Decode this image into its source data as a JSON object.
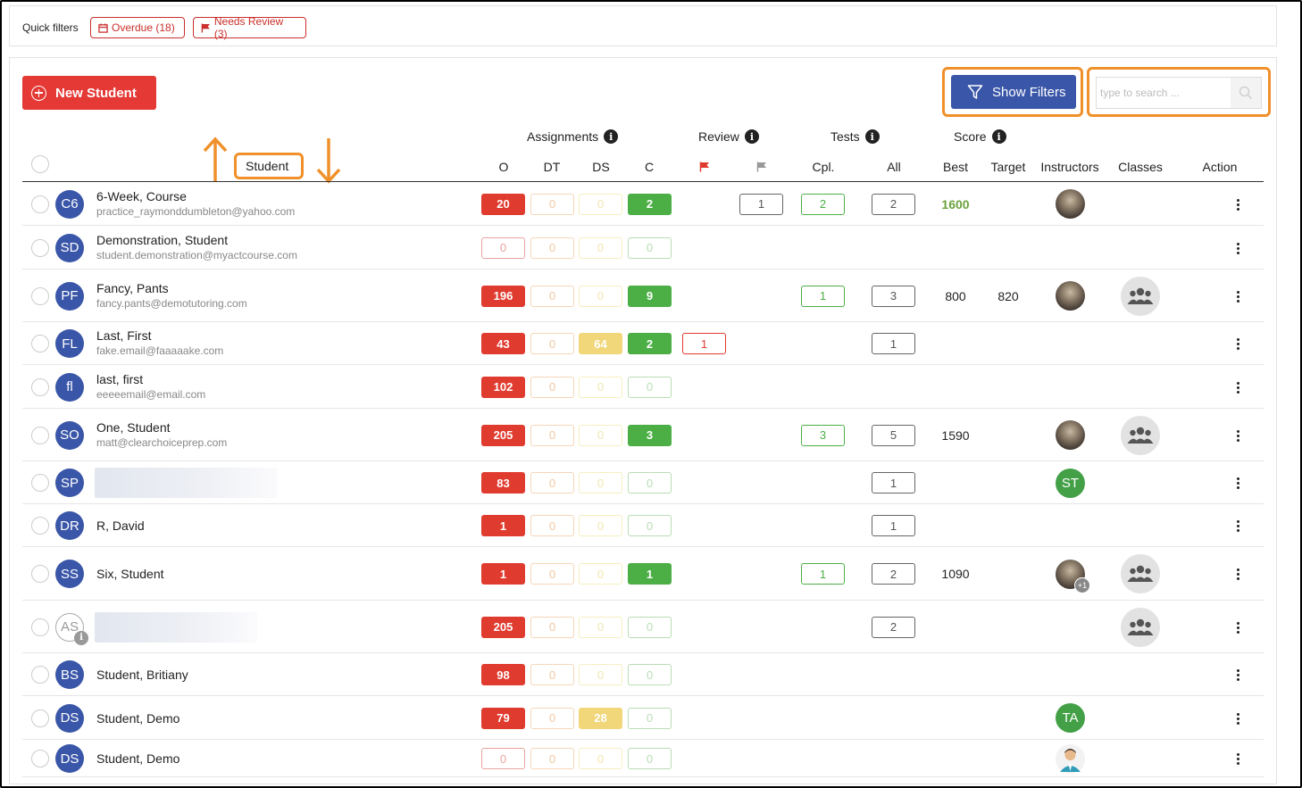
{
  "quick_filters": {
    "label": "Quick filters",
    "overdue": "Overdue (18)",
    "needs_review": "Needs Review (3)"
  },
  "toolbar": {
    "new_student": "New Student",
    "show_filters": "Show Filters",
    "search_placeholder": "type to search ..."
  },
  "groups": {
    "assignments": "Assignments",
    "review": "Review",
    "tests": "Tests",
    "score": "Score"
  },
  "columns": {
    "student": "Student",
    "o": "O",
    "dt": "DT",
    "ds": "DS",
    "c": "C",
    "cpl": "Cpl.",
    "all": "All",
    "best": "Best",
    "target": "Target",
    "instructors": "Instructors",
    "classes": "Classes",
    "action": "Action"
  },
  "colors": {
    "primary": "#e53935",
    "filter_button": "#3a56a8",
    "highlight": "#f0902a",
    "avatar": "#3a56a8",
    "green": "#4caf45"
  },
  "rows": [
    {
      "initials": "C6",
      "name": "6-Week, Course",
      "email": "practice_raymonddumbleton@yahoo.com",
      "o": "20",
      "dt": "0",
      "ds": "0",
      "c": "2",
      "review_flag": "",
      "review_other": "1",
      "cpl": "2",
      "all": "2",
      "best": "1600",
      "target": "",
      "instructor": "photo",
      "classes": false
    },
    {
      "initials": "SD",
      "name": "Demonstration, Student",
      "email": "student.demonstration@myactcourse.com",
      "o": "0",
      "dt": "0",
      "ds": "0",
      "c": "0",
      "review_flag": "",
      "review_other": "",
      "cpl": "",
      "all": "",
      "best": "",
      "target": "",
      "instructor": "",
      "classes": false
    },
    {
      "initials": "PF",
      "name": "Fancy, Pants",
      "email": "fancy.pants@demotutoring.com",
      "o": "196",
      "dt": "0",
      "ds": "0",
      "c": "9",
      "review_flag": "",
      "review_other": "",
      "cpl": "1",
      "all": "3",
      "best": "800",
      "target": "820",
      "instructor": "photo",
      "classes": true
    },
    {
      "initials": "FL",
      "name": "Last, First",
      "email": "fake.email@faaaaake.com",
      "o": "43",
      "dt": "0",
      "ds": "64",
      "c": "2",
      "review_flag": "1",
      "review_other": "",
      "cpl": "",
      "all": "1",
      "best": "",
      "target": "",
      "instructor": "",
      "classes": false
    },
    {
      "initials": "fl",
      "name": "last, first",
      "email": "eeeeemail@email.com",
      "o": "102",
      "dt": "0",
      "ds": "0",
      "c": "0",
      "review_flag": "",
      "review_other": "",
      "cpl": "",
      "all": "",
      "best": "",
      "target": "",
      "instructor": "",
      "classes": false
    },
    {
      "initials": "SO",
      "name": "One, Student",
      "email": "matt@clearchoiceprep.com",
      "o": "205",
      "dt": "0",
      "ds": "0",
      "c": "3",
      "review_flag": "",
      "review_other": "",
      "cpl": "3",
      "all": "5",
      "best": "1590",
      "target": "",
      "instructor": "photo",
      "classes": true
    },
    {
      "initials": "SP",
      "name": "",
      "email": "",
      "o": "83",
      "dt": "0",
      "ds": "0",
      "c": "0",
      "review_flag": "",
      "review_other": "",
      "cpl": "",
      "all": "1",
      "best": "",
      "target": "",
      "instructor": "ST",
      "classes": false
    },
    {
      "initials": "DR",
      "name": "R, David",
      "email": "",
      "o": "1",
      "dt": "0",
      "ds": "0",
      "c": "0",
      "review_flag": "",
      "review_other": "",
      "cpl": "",
      "all": "1",
      "best": "",
      "target": "",
      "instructor": "",
      "classes": false
    },
    {
      "initials": "SS",
      "name": "Six, Student",
      "email": "",
      "o": "1",
      "dt": "0",
      "ds": "0",
      "c": "1",
      "review_flag": "",
      "review_other": "",
      "cpl": "1",
      "all": "2",
      "best": "1090",
      "target": "",
      "instructor": "photo+1",
      "classes": true
    },
    {
      "initials": "AS",
      "name": "",
      "email": "",
      "o": "205",
      "dt": "0",
      "ds": "0",
      "c": "0",
      "review_flag": "",
      "review_other": "",
      "cpl": "",
      "all": "2",
      "best": "",
      "target": "",
      "instructor": "",
      "classes": true
    },
    {
      "initials": "BS",
      "name": "Student, Britiany",
      "email": "",
      "o": "98",
      "dt": "0",
      "ds": "0",
      "c": "0",
      "review_flag": "",
      "review_other": "",
      "cpl": "",
      "all": "",
      "best": "",
      "target": "",
      "instructor": "",
      "classes": false
    },
    {
      "initials": "DS",
      "name": "Student, Demo",
      "email": "",
      "o": "79",
      "dt": "0",
      "ds": "28",
      "c": "0",
      "review_flag": "",
      "review_other": "",
      "cpl": "",
      "all": "",
      "best": "",
      "target": "",
      "instructor": "TA",
      "classes": false
    },
    {
      "initials": "DS",
      "name": "Student, Demo",
      "email": "",
      "o": "0",
      "dt": "0",
      "ds": "0",
      "c": "0",
      "review_flag": "",
      "review_other": "",
      "cpl": "",
      "all": "",
      "best": "",
      "target": "",
      "instructor": "person",
      "classes": false
    }
  ],
  "instructor_badges": {
    "ST": "ST",
    "TA": "TA",
    "plus_one": "+1"
  }
}
